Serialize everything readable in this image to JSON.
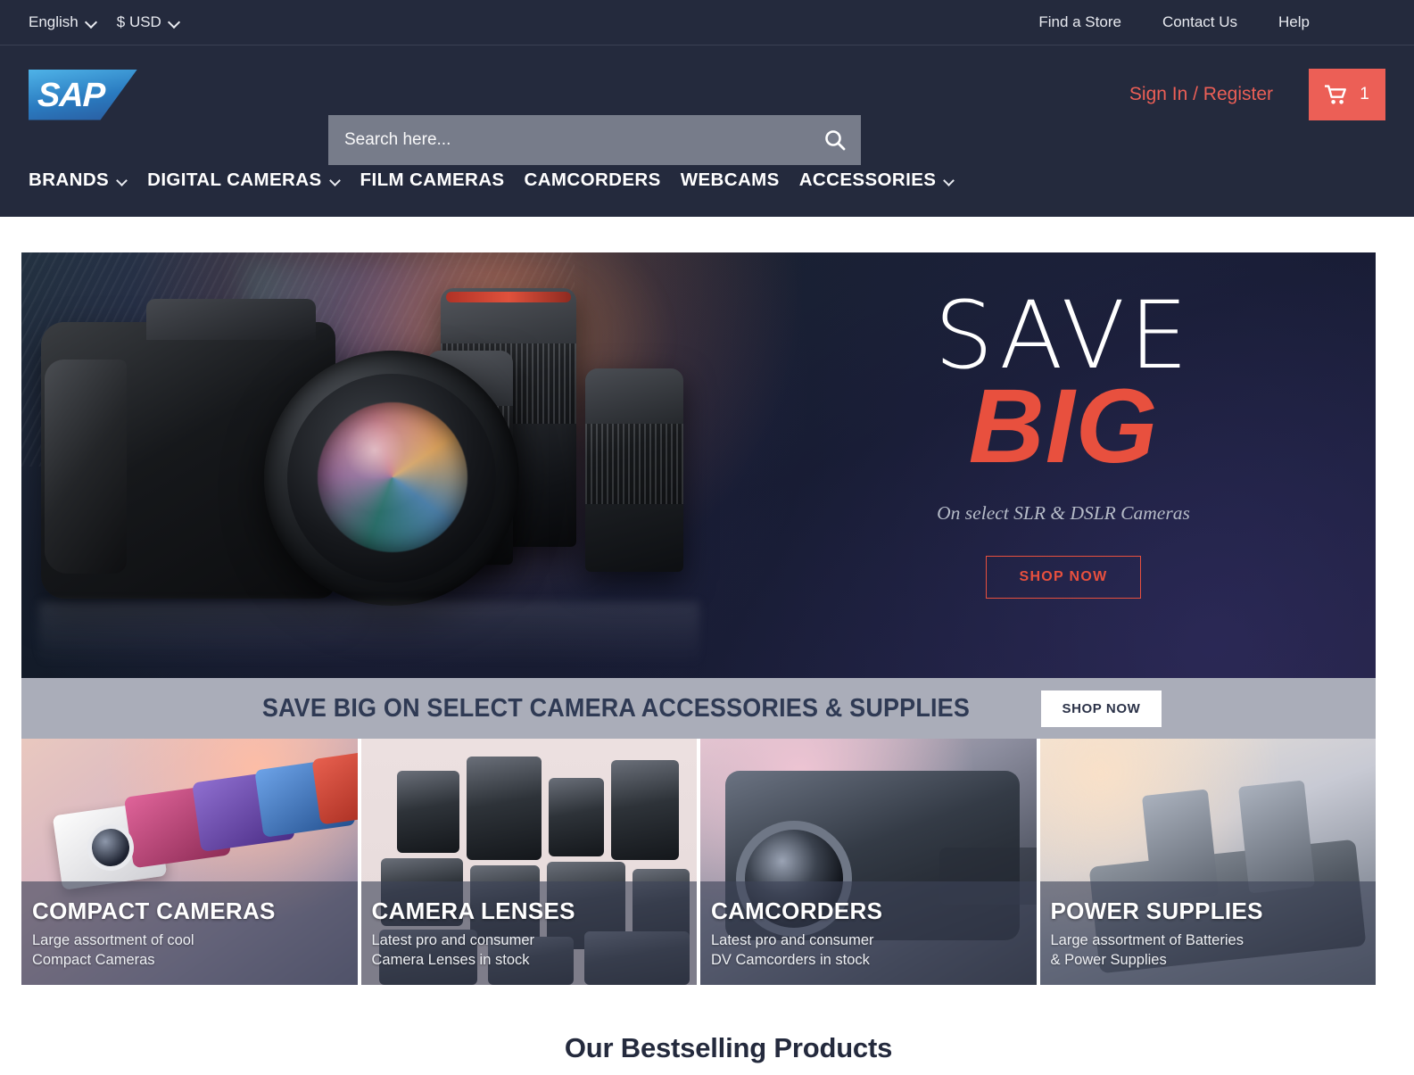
{
  "topbar": {
    "language": "English",
    "currency": "$ USD",
    "links": [
      "Find a Store",
      "Contact Us",
      "Help"
    ]
  },
  "brand": {
    "logo_text": "SAP",
    "logo_name": "sap-logo"
  },
  "search": {
    "placeholder": "Search here...",
    "value": "",
    "icon": "search-icon"
  },
  "account": {
    "signin_label": "Sign In / Register",
    "cart_icon": "shopping-cart-icon",
    "cart_count": "1"
  },
  "nav": {
    "items": [
      {
        "label": "BRANDS",
        "has_dropdown": true
      },
      {
        "label": "DIGITAL CAMERAS",
        "has_dropdown": true
      },
      {
        "label": "FILM CAMERAS",
        "has_dropdown": false
      },
      {
        "label": "CAMCORDERS",
        "has_dropdown": false
      },
      {
        "label": "WEBCAMS",
        "has_dropdown": false
      },
      {
        "label": "ACCESSORIES",
        "has_dropdown": true
      }
    ]
  },
  "hero": {
    "headline_top": "SAVE",
    "headline_bottom": "BIG",
    "subtext": "On select SLR & DSLR Cameras",
    "cta_label": "SHOP NOW"
  },
  "promo": {
    "text": "SAVE BIG ON SELECT CAMERA ACCESSORIES & SUPPLIES",
    "cta_label": "SHOP NOW"
  },
  "tiles": [
    {
      "title": "COMPACT CAMERAS",
      "desc": "Large assortment of cool\nCompact Cameras"
    },
    {
      "title": "CAMERA LENSES",
      "desc": "Latest pro and consumer\nCamera Lenses in stock"
    },
    {
      "title": "CAMCORDERS",
      "desc": "Latest pro and consumer\nDV Camcorders in stock"
    },
    {
      "title": "POWER SUPPLIES",
      "desc": "Large assortment of Batteries\n& Power Supplies"
    }
  ],
  "bestselling": {
    "title": "Our Bestselling Products"
  },
  "colors": {
    "header_bg": "#242a3d",
    "accent_red": "#ec5f56",
    "hero_red": "#e8503e",
    "promo_bg": "#aaadb9",
    "search_bg": "#777c8a"
  }
}
